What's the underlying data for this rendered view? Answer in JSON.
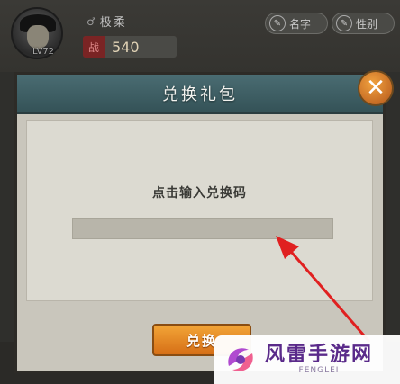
{
  "profile": {
    "avatar_level": "LV72",
    "name": "极柔",
    "gender_icon": "gender-icon",
    "power_badge": "战",
    "power_value": "540",
    "rename_label": "名字",
    "gender_label": "性别"
  },
  "dialog": {
    "title": "兑换礼包",
    "close_symbol": "✕",
    "hint": "点击输入兑换码",
    "code_input_value": "",
    "exchange_label": "兑换"
  },
  "watermark": {
    "title": "风雷手游网",
    "subtitle": "FENGLEI"
  },
  "colors": {
    "header": "#3f5f65",
    "exchange_button": "#e8891f",
    "close_button": "#e07a2a",
    "arrow": "#e02020",
    "watermark_text": "#5a2a8a"
  }
}
